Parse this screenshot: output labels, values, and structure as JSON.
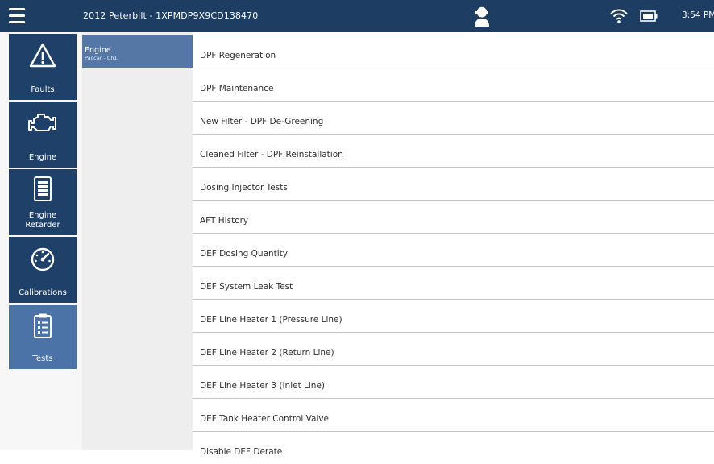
{
  "header": {
    "vehicle_title": "2012 Peterbilt - 1XPMDP9X9CD138470",
    "time": "3:54 PM",
    "icons": [
      "menu-icon",
      "technician-icon",
      "wifi-icon",
      "battery-icon"
    ]
  },
  "nav": {
    "items": [
      {
        "label": "Faults",
        "icon": "warning-icon"
      },
      {
        "label": "Engine",
        "icon": "engine-icon"
      },
      {
        "label": "Engine Retarder",
        "icon": "retarder-icon"
      },
      {
        "label": "Calibrations",
        "icon": "speedometer-icon"
      },
      {
        "label": "Tests",
        "icon": "clipboard-icon"
      }
    ],
    "active": "Tests"
  },
  "sub_nav": {
    "title": "Engine",
    "subtitle": "Paccar - Ch1"
  },
  "tests": [
    "DPF Regeneration",
    "DPF Maintenance",
    "New Filter - DPF De-Greening",
    "Cleaned Filter - DPF Reinstallation",
    "Dosing Injector Tests",
    "AFT History",
    "DEF Dosing Quantity",
    "DEF System Leak Test",
    "DEF Line Heater 1 (Pressure Line)",
    "DEF Line Heater 2 (Return Line)",
    "DEF Line Heater 3 (Inlet Line)",
    "DEF Tank Heater Control Valve",
    "Disable DEF Derate"
  ],
  "colors": {
    "header_bg": "#1d3d63",
    "nav_bg": "#1f4169",
    "nav_active_bg": "#4b73a8",
    "sub_active_bg": "#5577a6"
  }
}
